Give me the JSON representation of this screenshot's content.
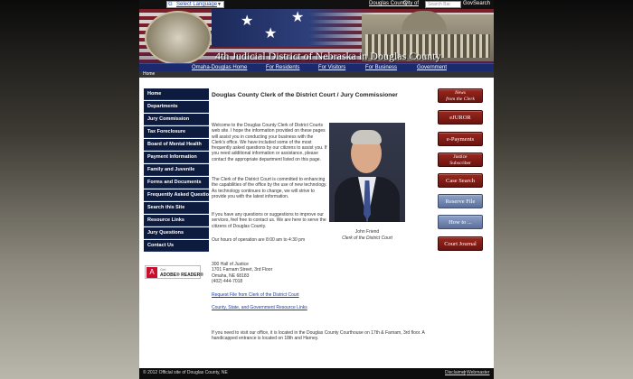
{
  "topbar": {
    "language": "Select Language",
    "links": [
      "Douglas County",
      "City of"
    ],
    "search_placeholder": "Search Bar",
    "gov_search": "GovSearch"
  },
  "banner": {
    "title": "4th Judicial District of Nebraska in Douglas County"
  },
  "nav": {
    "items": [
      "Omaha-Douglas Home",
      "For Residents",
      "For Visitors",
      "For Business",
      "Government"
    ]
  },
  "breadcrumb": "Home",
  "sidebar": {
    "items": [
      "Home",
      "Departments",
      "Jury Commission",
      "Tax Foreclosure",
      "Board of Mental Health",
      "Payment Information",
      "Family and Juvenile",
      "Forms and Documents",
      "Frequently Asked Questions",
      "Search this Site",
      "Resource Links",
      "Jury Questions",
      "Contact Us"
    ],
    "adobe": {
      "get": "Get",
      "label": "ADOBE® READER®"
    }
  },
  "main": {
    "heading": "Douglas County Clerk of the District Court / Jury Commissioner",
    "intro": "Welcome to the Douglas County Clerk of District Courts web site. I hope the information provided on these pages will assist you in conducting your business with the Clerk's office. We have included some of the most frequently asked questions by our citizens to assist you. If you need additional information or assistance, please contact the appropriate department listed on this page.",
    "commitment": "The Clerk of the District Court is committed to enhancing the capabilities of the office by the use of new technology. As technology continues to change, we will strive to provide you with the latest information.",
    "questions": "If you have any questions or suggestions to improve our services, feel free to contact us. We are here to serve the citizens of Douglas County.",
    "hours": "Our hours of operation are 8:00 am to 4:30 pm",
    "photo_caption_name": "John Friend",
    "photo_caption_title": "Clerk of the District Court",
    "address": [
      "300 Hall of Justice",
      "1701 Farnam Street, 3rd Floor",
      "Omaha, NE 68183",
      "(402) 444-7018"
    ],
    "link_request": "Request File from Clerk of the District Court",
    "link_resources": "County, State, and Government Resource Links",
    "visit": "If you need to visit our office, it is located in the Douglas County Courthouse on 17th & Farnam, 3rd floor.  A handicapped entrance is located on 18th and Harney."
  },
  "right_buttons": [
    {
      "line1": "News",
      "line2": "from the Clerk"
    },
    {
      "line1": "eJUROR",
      "line2": ""
    },
    {
      "line1": "e-Payments",
      "line2": ""
    },
    {
      "line1": "Justice",
      "line2": "Subscriber"
    },
    {
      "line1": "Case Search",
      "line2": ""
    },
    {
      "line1": "Reserve File",
      "line2": ""
    },
    {
      "line1": "How to ...",
      "line2": ""
    },
    {
      "line1": "Court Journal",
      "line2": ""
    }
  ],
  "footer": {
    "copyright": "© 2012 Official site of Douglas County, NE",
    "disclaimer": "Disclaimer",
    "webmaster": "Webmaster"
  }
}
